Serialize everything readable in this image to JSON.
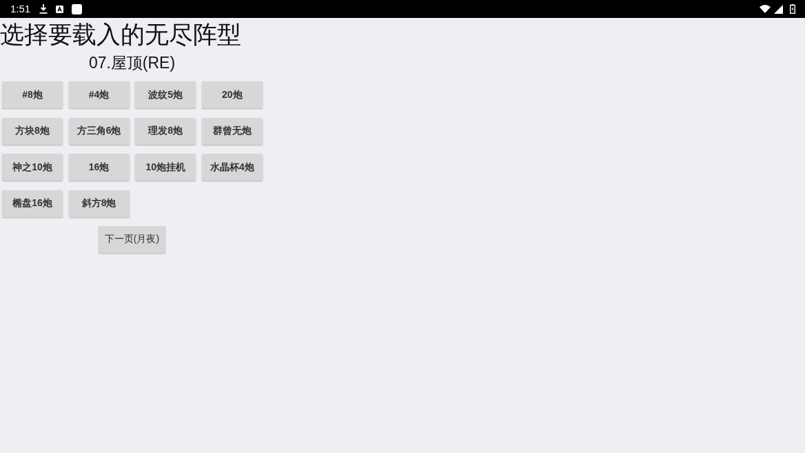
{
  "status_bar": {
    "time": "1:51"
  },
  "title": "选择要载入的无尽阵型",
  "subtitle": "07.屋顶(RE)",
  "formations": [
    "#8炮",
    "#4炮",
    "波纹5炮",
    "20炮",
    "方块8炮",
    "方三角6炮",
    "理发8炮",
    "群曾无炮",
    "神之10炮",
    "16炮",
    "10炮挂机",
    "水晶杯4炮",
    "椭盘16炮",
    "斜方8炮"
  ],
  "next_page_button": "下一页(月夜)"
}
